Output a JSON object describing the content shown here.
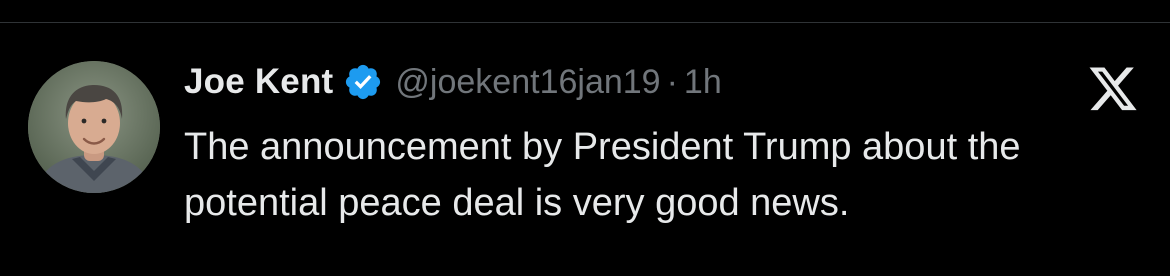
{
  "tweet": {
    "author_name": "Joe Kent",
    "handle": "@joekent16jan19",
    "separator": "·",
    "time": "1h",
    "text": "The announcement by President Trump about the potential peace deal is very good news.",
    "verified": true,
    "verified_color": "#1d9bf0"
  },
  "icons": {
    "verified": "verified-badge-icon",
    "brand": "x-logo-icon",
    "avatar": "profile-photo"
  },
  "colors": {
    "background": "#000000",
    "primary_text": "#e7e9ea",
    "secondary_text": "#71767b"
  }
}
